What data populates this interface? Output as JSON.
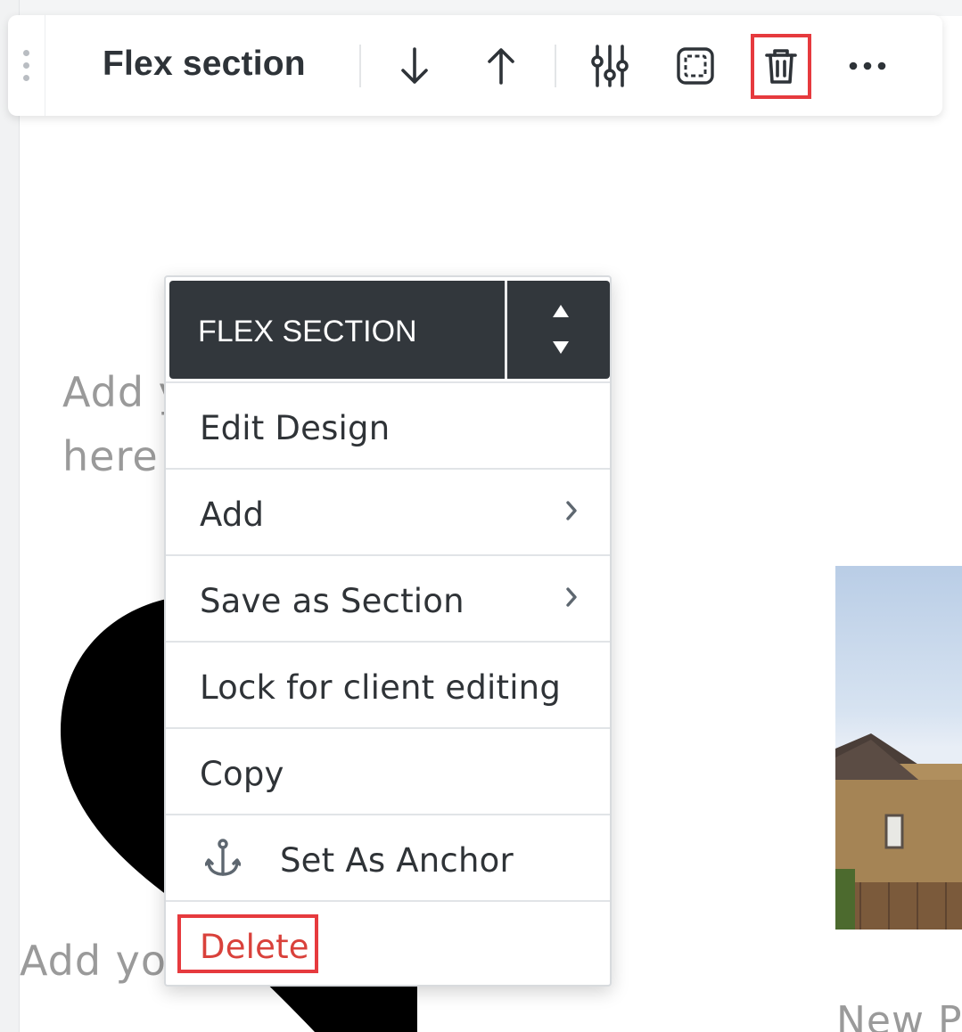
{
  "toolbar": {
    "title": "Flex section",
    "buttons": [
      {
        "name": "move-down",
        "icon": "arrow-down-icon"
      },
      {
        "name": "move-up",
        "icon": "arrow-up-icon"
      },
      {
        "name": "design",
        "icon": "sliders-icon"
      },
      {
        "name": "select",
        "icon": "frame-select-icon"
      },
      {
        "name": "delete",
        "icon": "trash-icon",
        "highlighted": true
      },
      {
        "name": "more",
        "icon": "more-horizontal-icon"
      }
    ]
  },
  "canvas": {
    "placeholder_line1": "Add y",
    "placeholder_line2": "here",
    "placeholder_bottom": "Add yo",
    "right_caption": "New P"
  },
  "context_menu": {
    "header": "FLEX SECTION",
    "items": [
      {
        "label": "Edit Design",
        "submenu": false
      },
      {
        "label": "Add",
        "submenu": true
      },
      {
        "label": "Save as Section",
        "submenu": true
      },
      {
        "label": "Lock for client editing",
        "submenu": false
      },
      {
        "label": "Copy",
        "submenu": false
      },
      {
        "label": "Set As Anchor",
        "icon": "anchor-icon",
        "submenu": false
      },
      {
        "label": "Delete",
        "submenu": false,
        "destructive": true,
        "highlighted": true
      }
    ]
  },
  "colors": {
    "highlight": "#e63a3e",
    "menu_header_bg": "#32373c",
    "delete_text": "#d9413b",
    "text_dark": "#2e3338"
  }
}
